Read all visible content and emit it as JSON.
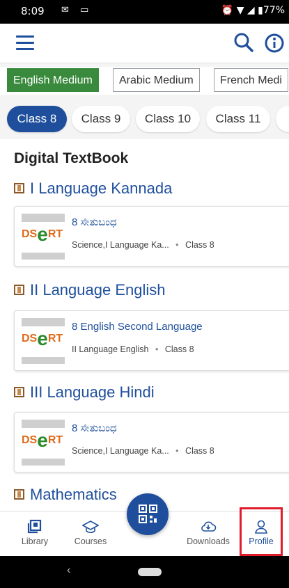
{
  "status_bar": {
    "time": "8:09",
    "battery": "77%"
  },
  "toolbar": {
    "menu_icon": "hamburger-icon",
    "search_icon": "search-icon",
    "info_icon": "info-icon"
  },
  "mediums": [
    {
      "label": "English Medium",
      "selected": true
    },
    {
      "label": "Arabic Medium",
      "selected": false
    },
    {
      "label": "French Medi",
      "selected": false
    }
  ],
  "classes": [
    {
      "label": "Class 8",
      "selected": true
    },
    {
      "label": "Class 9",
      "selected": false
    },
    {
      "label": "Class 10",
      "selected": false
    },
    {
      "label": "Class 11",
      "selected": false
    }
  ],
  "section_title": "Digital TextBook",
  "subjects": [
    {
      "name": "I Language Kannada",
      "book": {
        "logo": "DSERT",
        "title": "8 ಸೇತುಬಂಧ",
        "subjects": "Science,I Language Ka...",
        "separator": "•",
        "class": "Class 8"
      }
    },
    {
      "name": "II Language English",
      "book": {
        "logo": "DSERT",
        "title": "8 English Second Language",
        "subjects": "II Language English",
        "separator": "•",
        "class": "Class 8"
      }
    },
    {
      "name": "III Language Hindi",
      "book": {
        "logo": "DSERT",
        "title": "8 ಸೇತುಬಂಧ",
        "subjects": "Science,I Language Ka...",
        "separator": "•",
        "class": "Class 8"
      }
    },
    {
      "name": "Mathematics"
    }
  ],
  "bottom_nav": {
    "library": "Library",
    "courses": "Courses",
    "downloads": "Downloads",
    "profile": "Profile"
  },
  "colors": {
    "primary": "#1f4f9c",
    "medium_active": "#3a8a3e",
    "highlight": "#e01b2a"
  }
}
